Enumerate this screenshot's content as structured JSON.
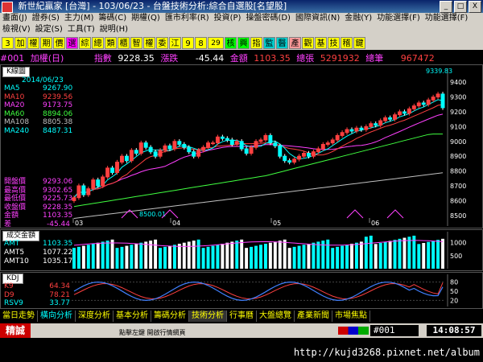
{
  "window": {
    "title": "新世紀贏家 [台灣] - 103/06/23 - 台盤技術分析:綜合自選股[名望股]",
    "min": "_",
    "max": "□",
    "close": "X"
  },
  "menu": {
    "row1": [
      "畫面(J)",
      "證券(S)",
      "主力(M)",
      "籌碼(C)",
      "期權(Q)",
      "匯市利率(R)",
      "投資(P)",
      "操盤密碼(D)",
      "國際資訊(N)",
      "金融(Y)",
      "功能選擇(F)",
      "功能選擇(F)"
    ],
    "row2": [
      "檢視(V)",
      "設定(S)",
      "工具(T)",
      "說明(H)"
    ]
  },
  "toolbar": [
    "3",
    "加",
    "權",
    "期",
    "價",
    "選",
    "綜",
    "總",
    "類",
    "櫃",
    "智",
    "權",
    "委",
    "江",
    "9",
    "8",
    "29",
    "核",
    "興",
    "指",
    "監",
    "醫",
    "產",
    "觀",
    "基",
    "技",
    "稽",
    "鍵"
  ],
  "info": {
    "code": "#001",
    "name": "加權(日)",
    "index_label": "指數",
    "index_value": "9228.35",
    "change_label": "漲跌",
    "change_value": "-45.44",
    "amount_label": "金額",
    "amount_value": "1103.35",
    "volume_label": "總張",
    "volume_value": "5291932",
    "trades_label": "總筆",
    "trades_value": "967472"
  },
  "kline": {
    "header": "K線圖",
    "date": "2014/06/23",
    "ma": [
      {
        "name": "MA5",
        "value": "9267.90",
        "color": "#00ffff"
      },
      {
        "name": "MA10",
        "value": "9239.56",
        "color": "#ff4040"
      },
      {
        "name": "MA20",
        "value": "9173.75",
        "color": "#ff40ff"
      },
      {
        "name": "MA60",
        "value": "8894.06",
        "color": "#40ff40"
      },
      {
        "name": "MA108",
        "value": "8805.38",
        "color": "#c0c0c0"
      },
      {
        "name": "MA240",
        "value": "8487.31",
        "color": "#00ffff"
      }
    ],
    "ohlc": [
      {
        "name": "開盤價",
        "value": "9293.06",
        "color": "#ff40ff"
      },
      {
        "name": "最高價",
        "value": "9302.65",
        "color": "#ff40ff"
      },
      {
        "name": "最低價",
        "value": "9225.73",
        "color": "#ff40ff"
      },
      {
        "name": "收盤價",
        "value": "9228.35",
        "color": "#ff40ff"
      },
      {
        "name": "金額",
        "value": "1103.35",
        "color": "#ff40ff"
      },
      {
        "name": "差",
        "value": "-45.44",
        "color": "#ff40ff"
      }
    ],
    "peak_label": "9339.83",
    "low_label": "8500.01",
    "y_ticks": [
      "9400",
      "9300",
      "9200",
      "9100",
      "9000",
      "8900",
      "8800",
      "8700",
      "8600",
      "8500"
    ],
    "months": [
      "03",
      "04",
      "05",
      "06"
    ]
  },
  "volume": {
    "header": "成交金額",
    "rows": [
      {
        "name": "AMT",
        "value": "1103.35",
        "color": "#00ffff"
      },
      {
        "name": "AMT5",
        "value": "1077.22",
        "color": "#ffffff"
      },
      {
        "name": "AMT10",
        "value": "1035.17",
        "color": "#ffffff"
      }
    ],
    "y_ticks": [
      "1000",
      "500"
    ]
  },
  "kdj": {
    "header": "KDJ",
    "rows": [
      {
        "name": "K9",
        "value": "64.34",
        "color": "#ff4040"
      },
      {
        "name": "D9",
        "value": "78.21",
        "color": "#ff4040"
      },
      {
        "name": "RSV9",
        "value": "33.77",
        "color": "#00ffff"
      }
    ],
    "y_ticks": [
      "80",
      "50",
      "20"
    ]
  },
  "tabs": [
    "當日走勢",
    "橫向分析",
    "深度分析",
    "基本分析",
    "籌碼分析",
    "技術分析",
    "行事曆",
    "大盤總覽",
    "產業新聞",
    "市場焦點"
  ],
  "status": {
    "hint": "點擊左鍵 開啟行情網頁",
    "code": "#001",
    "time": "14:08:57"
  },
  "brand": "精誠",
  "url": "http://kujd3268.pixnet.net/album"
}
